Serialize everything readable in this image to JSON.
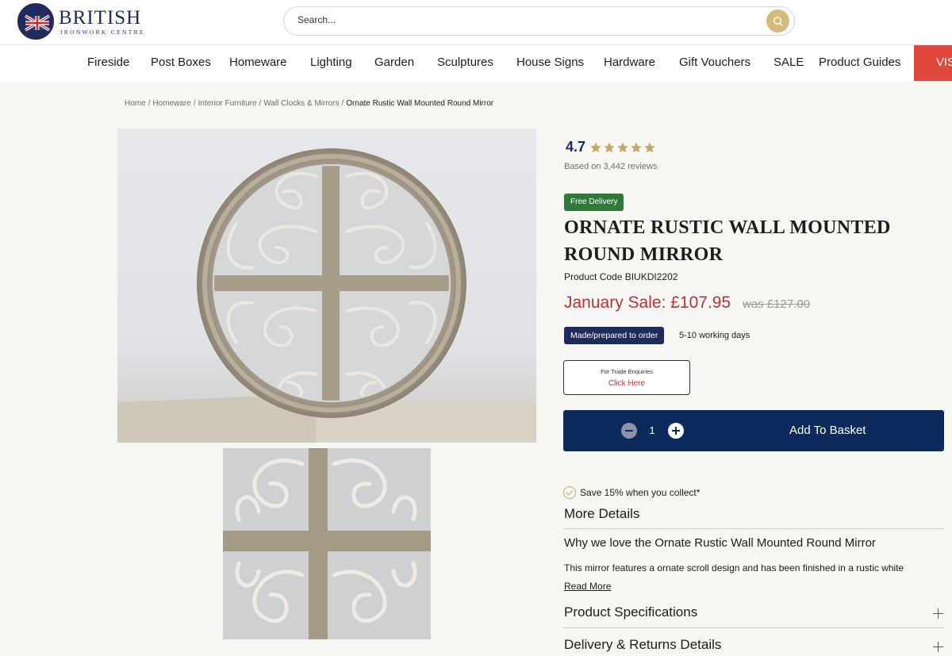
{
  "brand": {
    "title": "BRITISH",
    "subtitle": "IRONWORK CENTRE"
  },
  "search": {
    "placeholder": "Search..."
  },
  "nav": {
    "items": [
      "Fireside",
      "Post Boxes",
      "Homeware",
      "Lighting",
      "Garden",
      "Sculptures",
      "House Signs",
      "Hardware",
      "Gift Vouchers",
      "SALE",
      "Product Guides"
    ],
    "cta": "VIS"
  },
  "breadcrumb": {
    "items": [
      "Home",
      "Homeware",
      "Interior Furniture",
      "Wall Clocks & Mirrors"
    ],
    "current": "Ornate Rustic Wall Mounted Round Mirror"
  },
  "product": {
    "rating": "4.7",
    "stars": 5,
    "reviews": "Based on 3,442 reviews",
    "free_delivery": "Free Delivery",
    "title": "ORNATE RUSTIC WALL MOUNTED ROUND MIRROR",
    "code": "Product Code BIUKDI2202",
    "price": "January Sale: £107.95",
    "was_price": "was £127.00",
    "made_badge": "Made/prepared to order",
    "lead_time": "5-10 working days",
    "trade_top": "For Trade Enquiries",
    "trade_link": "Click Here",
    "quantity": "1",
    "add_to_basket": "Add To Basket",
    "collect": "Save 15% when you collect*"
  },
  "details": {
    "heading": "More Details",
    "why": "Why we love the Ornate Rustic Wall Mounted Round Mirror",
    "description": "This mirror features a ornate scroll design and has been finished in a rustic white",
    "read_more": "Read More",
    "specs": "Product Specifications",
    "delivery": "Delivery & Returns Details"
  },
  "colors": {
    "navy": "#0d2a5c",
    "sale_red": "#c0303b",
    "free_green": "#2f7a3a",
    "gold": "#d5ba7c",
    "star": "#c4a86a"
  }
}
